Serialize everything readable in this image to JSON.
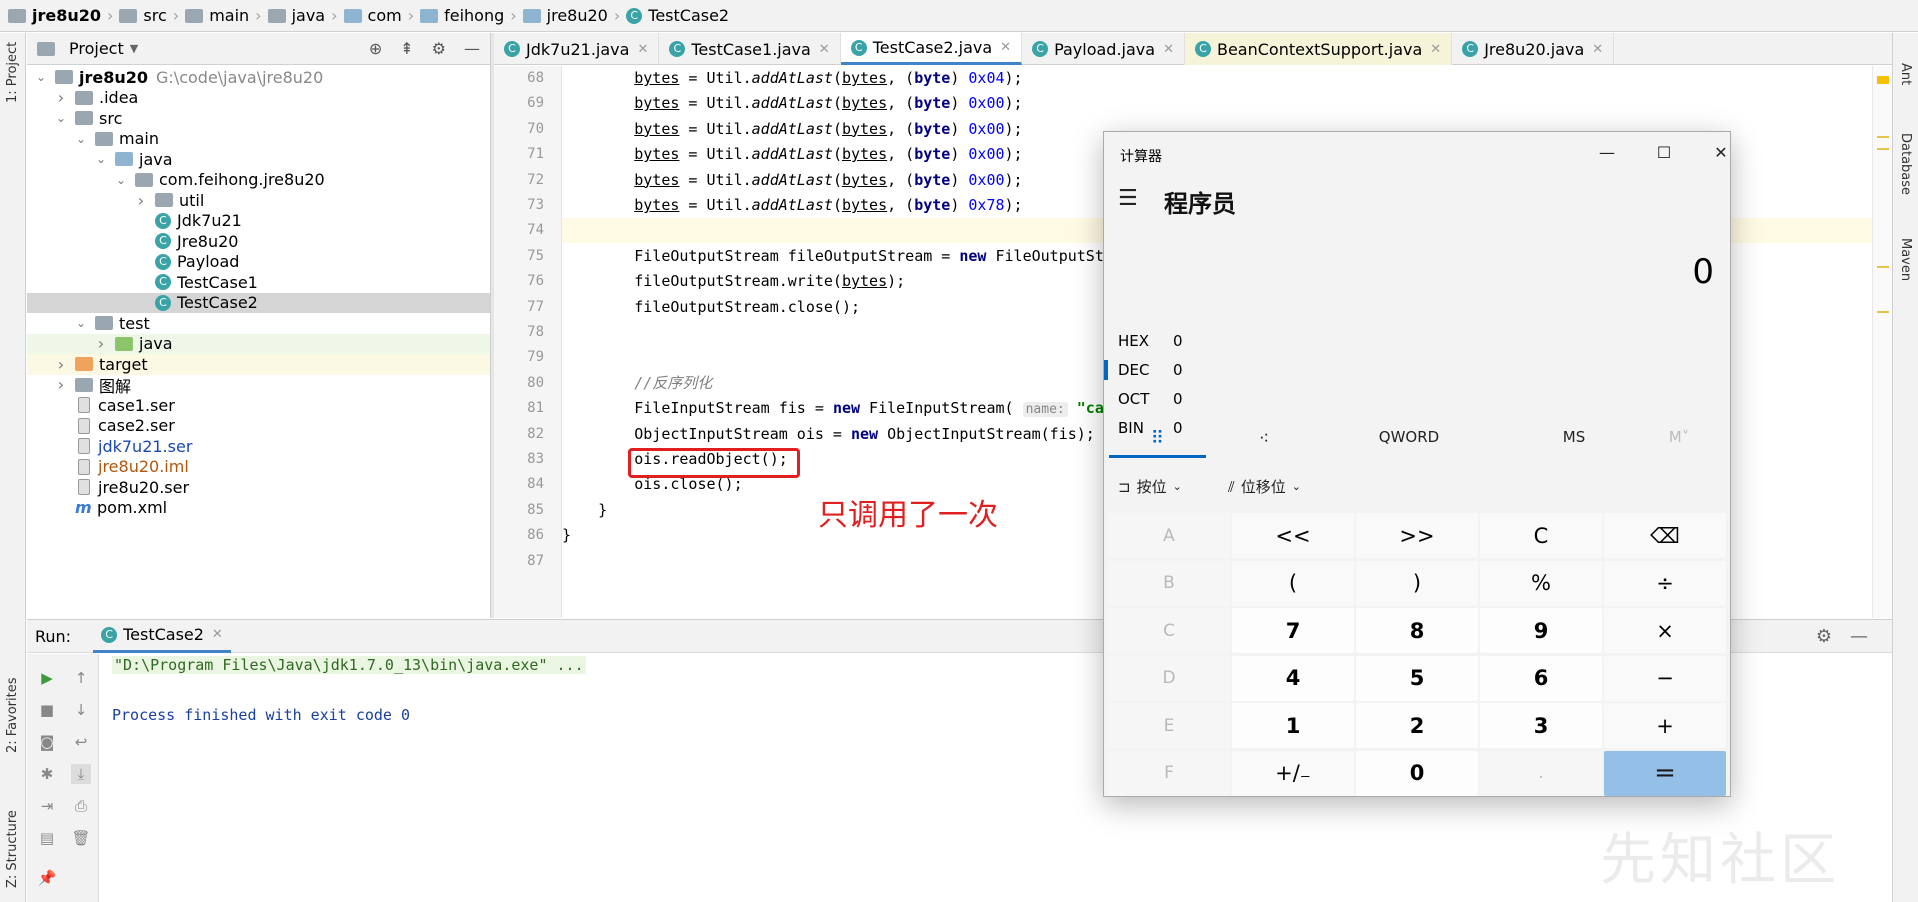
{
  "breadcrumb": [
    {
      "label": "jre8u20",
      "bold": true,
      "icon": "module-folder-icon"
    },
    {
      "label": "src",
      "icon": "folder-icon"
    },
    {
      "label": "main",
      "icon": "folder-icon"
    },
    {
      "label": "java",
      "icon": "source-folder-icon"
    },
    {
      "label": "com",
      "icon": "package-icon"
    },
    {
      "label": "feihong",
      "icon": "package-icon"
    },
    {
      "label": "jre8u20",
      "icon": "package-icon"
    },
    {
      "label": "TestCase2",
      "icon": "java-class-icon"
    }
  ],
  "left_strip": {
    "project": "1: Project",
    "favorites": "2: Favorites",
    "structure": "Z: Structure"
  },
  "right_strip": {
    "ant": "Ant",
    "database": "Database",
    "maven": "Maven"
  },
  "project_panel": {
    "title": "Project"
  },
  "tree": [
    {
      "label": "jre8u20",
      "extra": "G:\\code\\java\\jre8u20",
      "indent": 0,
      "arrow": "down",
      "icon": "gray",
      "bold": true
    },
    {
      "label": ".idea",
      "indent": 1,
      "arrow": "right",
      "icon": "gray"
    },
    {
      "label": "src",
      "indent": 1,
      "arrow": "down",
      "icon": "gray"
    },
    {
      "label": "main",
      "indent": 2,
      "arrow": "down",
      "icon": "gray"
    },
    {
      "label": "java",
      "indent": 3,
      "arrow": "down",
      "icon": "blue"
    },
    {
      "label": "com.feihong.jre8u20",
      "indent": 4,
      "arrow": "down",
      "icon": "gray"
    },
    {
      "label": "util",
      "indent": 5,
      "arrow": "right",
      "icon": "gray"
    },
    {
      "label": "Jdk7u21",
      "indent": 5,
      "arrow": "",
      "icon": "class"
    },
    {
      "label": "Jre8u20",
      "indent": 5,
      "arrow": "",
      "icon": "class"
    },
    {
      "label": "Payload",
      "indent": 5,
      "arrow": "",
      "icon": "class"
    },
    {
      "label": "TestCase1",
      "indent": 5,
      "arrow": "",
      "icon": "class"
    },
    {
      "label": "TestCase2",
      "indent": 5,
      "arrow": "",
      "icon": "class",
      "selected": true
    },
    {
      "label": "test",
      "indent": 2,
      "arrow": "down",
      "icon": "gray"
    },
    {
      "label": "java",
      "indent": 3,
      "arrow": "right",
      "icon": "green",
      "style": "testsel"
    },
    {
      "label": "target",
      "indent": 1,
      "arrow": "right",
      "icon": "orange",
      "style": "tgt"
    },
    {
      "label": "图解",
      "indent": 1,
      "arrow": "right",
      "icon": "gray"
    },
    {
      "label": "case1.ser",
      "indent": 1,
      "arrow": "",
      "icon": "doc"
    },
    {
      "label": "case2.ser",
      "indent": 1,
      "arrow": "",
      "icon": "doc"
    },
    {
      "label": "jdk7u21.ser",
      "indent": 1,
      "arrow": "",
      "icon": "doc",
      "color": "blue"
    },
    {
      "label": "jre8u20.iml",
      "indent": 1,
      "arrow": "",
      "icon": "doc",
      "color": "orange"
    },
    {
      "label": "jre8u20.ser",
      "indent": 1,
      "arrow": "",
      "icon": "doc"
    },
    {
      "label": "pom.xml",
      "indent": 1,
      "arrow": "",
      "icon": "maven"
    }
  ],
  "tabs": [
    {
      "label": "Jdk7u21.java"
    },
    {
      "label": "TestCase1.java"
    },
    {
      "label": "TestCase2.java",
      "active": true
    },
    {
      "label": "Payload.java"
    },
    {
      "label": "BeanContextSupport.java",
      "style": "bean"
    },
    {
      "label": "Jre8u20.java"
    }
  ],
  "editor": {
    "line_numbers": [
      "68",
      "69",
      "70",
      "71",
      "72",
      "73",
      "74",
      "75",
      "76",
      "77",
      "78",
      "79",
      "80",
      "81",
      "82",
      "83",
      "84",
      "85",
      "86",
      "87"
    ],
    "code": [
      {
        "segs": [
          [
            "        ",
            ""
          ],
          [
            "bytes",
            "ul"
          ],
          [
            " = Util.",
            ""
          ],
          [
            "addAtLast",
            "it"
          ],
          [
            "(",
            ""
          ],
          [
            "bytes",
            "ul"
          ],
          [
            ", (",
            ""
          ],
          [
            "byte",
            "kw"
          ],
          [
            ") ",
            ""
          ],
          [
            "0x04",
            "num"
          ],
          [
            ");",
            ""
          ]
        ]
      },
      {
        "segs": [
          [
            "        ",
            ""
          ],
          [
            "bytes",
            "ul"
          ],
          [
            " = Util.",
            ""
          ],
          [
            "addAtLast",
            "it"
          ],
          [
            "(",
            ""
          ],
          [
            "bytes",
            "ul"
          ],
          [
            ", (",
            ""
          ],
          [
            "byte",
            "kw"
          ],
          [
            ") ",
            ""
          ],
          [
            "0x00",
            "num"
          ],
          [
            ");",
            ""
          ]
        ]
      },
      {
        "segs": [
          [
            "        ",
            ""
          ],
          [
            "bytes",
            "ul"
          ],
          [
            " = Util.",
            ""
          ],
          [
            "addAtLast",
            "it"
          ],
          [
            "(",
            ""
          ],
          [
            "bytes",
            "ul"
          ],
          [
            ", (",
            ""
          ],
          [
            "byte",
            "kw"
          ],
          [
            ") ",
            ""
          ],
          [
            "0x00",
            "num"
          ],
          [
            ");",
            ""
          ]
        ]
      },
      {
        "segs": [
          [
            "        ",
            ""
          ],
          [
            "bytes",
            "ul"
          ],
          [
            " = Util.",
            ""
          ],
          [
            "addAtLast",
            "it"
          ],
          [
            "(",
            ""
          ],
          [
            "bytes",
            "ul"
          ],
          [
            ", (",
            ""
          ],
          [
            "byte",
            "kw"
          ],
          [
            ") ",
            ""
          ],
          [
            "0x00",
            "num"
          ],
          [
            ");",
            ""
          ]
        ]
      },
      {
        "segs": [
          [
            "        ",
            ""
          ],
          [
            "bytes",
            "ul"
          ],
          [
            " = Util.",
            ""
          ],
          [
            "addAtLast",
            "it"
          ],
          [
            "(",
            ""
          ],
          [
            "bytes",
            "ul"
          ],
          [
            ", (",
            ""
          ],
          [
            "byte",
            "kw"
          ],
          [
            ") ",
            ""
          ],
          [
            "0x00",
            "num"
          ],
          [
            ");",
            ""
          ]
        ]
      },
      {
        "segs": [
          [
            "        ",
            ""
          ],
          [
            "bytes",
            "ul"
          ],
          [
            " = Util.",
            ""
          ],
          [
            "addAtLast",
            "it"
          ],
          [
            "(",
            ""
          ],
          [
            "bytes",
            "ul"
          ],
          [
            ", (",
            ""
          ],
          [
            "byte",
            "kw"
          ],
          [
            ") ",
            ""
          ],
          [
            "0x78",
            "num"
          ],
          [
            ");",
            ""
          ]
        ]
      },
      {
        "segs": [
          [
            "",
            ""
          ]
        ],
        "hl": true
      },
      {
        "segs": [
          [
            "        FileOutputStream fileOutputStream = ",
            ""
          ],
          [
            "new",
            "kw"
          ],
          [
            " FileOutputSt",
            ""
          ]
        ]
      },
      {
        "segs": [
          [
            "        fileOutputStream.write(",
            ""
          ],
          [
            "bytes",
            "ul"
          ],
          [
            ");",
            ""
          ]
        ]
      },
      {
        "segs": [
          [
            "        fileOutputStream.close();",
            ""
          ]
        ]
      },
      {
        "segs": [
          [
            "",
            ""
          ]
        ]
      },
      {
        "segs": [
          [
            "",
            ""
          ]
        ]
      },
      {
        "segs": [
          [
            "        ",
            ""
          ],
          [
            "//反序列化",
            "cmt"
          ]
        ]
      },
      {
        "segs": [
          [
            "        FileInputStream fis = ",
            ""
          ],
          [
            "new",
            "kw"
          ],
          [
            " FileInputStream( ",
            ""
          ],
          [
            "name:",
            "hint"
          ],
          [
            " ",
            ""
          ],
          [
            "\"ca",
            "str"
          ]
        ]
      },
      {
        "segs": [
          [
            "        ObjectInputStream ois = ",
            ""
          ],
          [
            "new",
            "kw"
          ],
          [
            " ObjectInputStream(fis);",
            ""
          ]
        ]
      },
      {
        "segs": [
          [
            "        ois.readObject();",
            ""
          ]
        ]
      },
      {
        "segs": [
          [
            "        ois.close();",
            ""
          ]
        ]
      },
      {
        "segs": [
          [
            "    }",
            ""
          ]
        ]
      },
      {
        "segs": [
          [
            "}",
            ""
          ]
        ]
      },
      {
        "segs": [
          [
            "",
            ""
          ]
        ]
      }
    ]
  },
  "annotation": "只调用了一次",
  "run_panel": {
    "label": "Run:",
    "tab": "TestCase2",
    "lines": [
      "\"D:\\Program Files\\Java\\jdk1.7.0_13\\bin\\java.exe\" ...",
      "",
      "Process finished with exit code 0"
    ]
  },
  "watermark": "先知社区",
  "calculator": {
    "title": "计算器",
    "mode": "程序员",
    "display": "0",
    "radix": [
      {
        "label": "HEX",
        "value": "0"
      },
      {
        "label": "DEC",
        "value": "0",
        "active": true
      },
      {
        "label": "OCT",
        "value": "0"
      },
      {
        "label": "BIN",
        "value": "0"
      }
    ],
    "tabs": {
      "keypad_icon": "⠿",
      "bits_icon": "⁖",
      "word": "QWORD",
      "ms": "MS",
      "mr": "M˅"
    },
    "bitwise": {
      "bitwise_label": "按位",
      "shift_label": "位移位"
    },
    "keys": [
      [
        "A",
        "<<",
        ">>",
        "C",
        "⌫"
      ],
      [
        "B",
        "(",
        ")",
        "%",
        "÷"
      ],
      [
        "C",
        "7",
        "8",
        "9",
        "×"
      ],
      [
        "D",
        "4",
        "5",
        "6",
        "−"
      ],
      [
        "E",
        "1",
        "2",
        "3",
        "+"
      ],
      [
        "F",
        "+/₋",
        "0",
        ".",
        "="
      ]
    ]
  },
  "colors": {
    "accent": "#4083c9",
    "annotation": "#e02020",
    "calc_accent": "#0067c0",
    "equals": "#94c0e8"
  }
}
